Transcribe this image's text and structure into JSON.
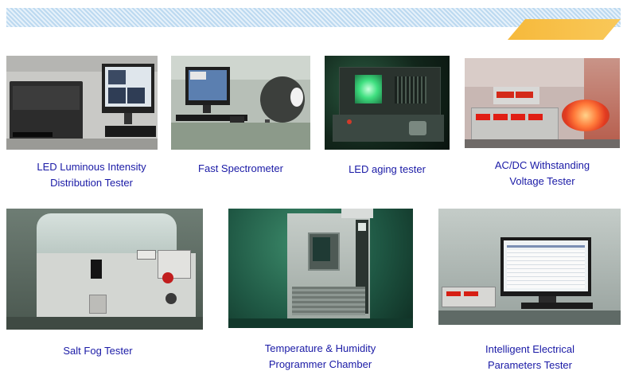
{
  "colors": {
    "caption": "#1a1aa6",
    "banner_stripe": "#bcd9f0",
    "accent": "#f6b93b"
  },
  "items": [
    {
      "caption": "LED Luminous Intensity\nDistribution Tester",
      "image": "led-luminous-intensity-tester-photo"
    },
    {
      "caption": "Fast Spectrometer",
      "image": "fast-spectrometer-photo"
    },
    {
      "caption": "LED aging tester",
      "image": "led-aging-tester-photo"
    },
    {
      "caption": "AC/DC Withstanding\nVoltage Tester",
      "image": "withstanding-voltage-tester-photo"
    },
    {
      "caption": "Salt Fog Tester",
      "image": "salt-fog-tester-photo"
    },
    {
      "caption": "Temperature & Humidity\nProgrammer Chamber",
      "image": "temperature-humidity-chamber-photo"
    },
    {
      "caption": "Intelligent Electrical\nParameters Tester",
      "image": "electrical-parameters-tester-photo"
    }
  ]
}
